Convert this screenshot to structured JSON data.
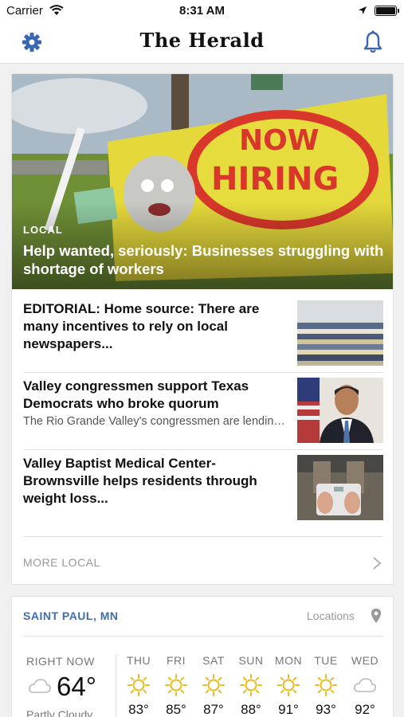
{
  "status_bar": {
    "carrier": "Carrier",
    "time": "8:31 AM"
  },
  "header": {
    "logo": "The Herald",
    "accent_color": "#3a67b1"
  },
  "featured": {
    "kicker": "LOCAL",
    "headline": "Help wanted, seriously: Businesses struggling with shortage of workers",
    "image": "now-hiring-banner-photo"
  },
  "stories": [
    {
      "title": "EDITORIAL: Home source: There are many incentives to rely on local newspapers...",
      "summary": "",
      "image": "newspaper-stack-photo"
    },
    {
      "title": "Valley congressmen support Texas Democrats who broke quorum",
      "summary": "The Rio Grande Valley's congressmen are lending their voice to the ongoing voting re...",
      "image": "congressman-portrait-photo"
    },
    {
      "title": "Valley Baptist Medical Center-Brownsville helps residents through weight loss...",
      "summary": "",
      "image": "bathroom-scale-photo"
    }
  ],
  "more_local": {
    "label": "MORE LOCAL"
  },
  "weather": {
    "city": "SAINT PAUL, MN",
    "locations_label": "Locations",
    "now": {
      "label": "RIGHT NOW",
      "temp": "64°",
      "condition": "Partly Cloudy",
      "icon": "cloud-icon"
    },
    "forecast": [
      {
        "day": "THU",
        "temp": "83°",
        "icon": "sun-icon"
      },
      {
        "day": "FRI",
        "temp": "85°",
        "icon": "sun-icon"
      },
      {
        "day": "SAT",
        "temp": "87°",
        "icon": "sun-icon"
      },
      {
        "day": "SUN",
        "temp": "88°",
        "icon": "sun-icon"
      },
      {
        "day": "MON",
        "temp": "91°",
        "icon": "sun-icon"
      },
      {
        "day": "TUE",
        "temp": "93°",
        "icon": "sun-icon"
      },
      {
        "day": "WED",
        "temp": "92°",
        "icon": "cloud-icon"
      }
    ]
  }
}
